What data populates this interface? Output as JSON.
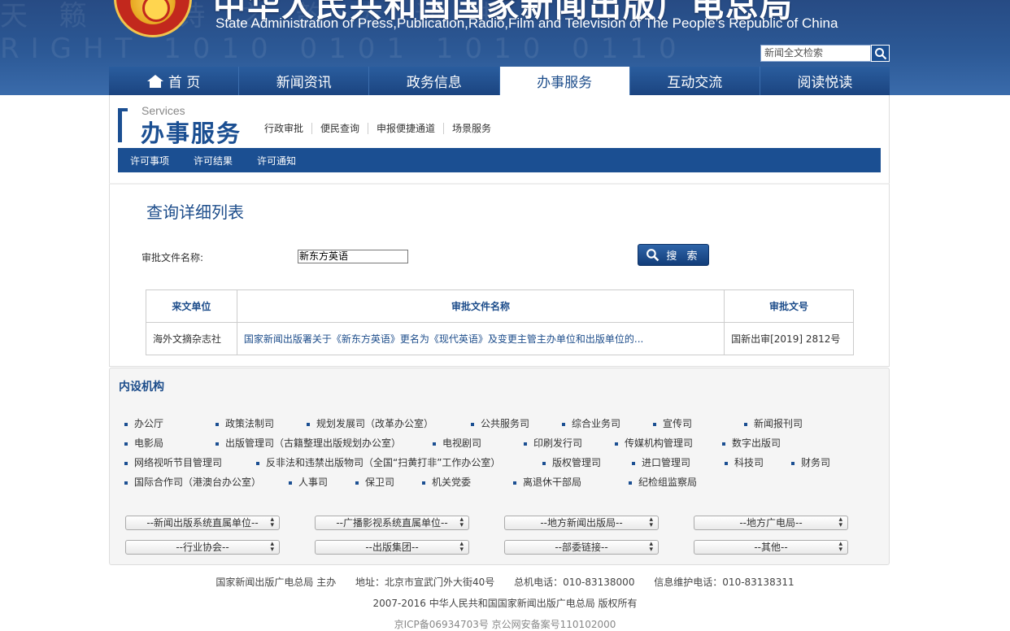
{
  "header": {
    "site_name_cn": "中华人民共和国国家新闻出版广电总局",
    "site_name_en": "State Administration of Press,Publication,Radio,Film and Television of The People’s Republic of China",
    "search_placeholder": "新闻全文检索",
    "nav": [
      {
        "label": "首 页",
        "active": false
      },
      {
        "label": "新闻资讯",
        "active": false
      },
      {
        "label": "政务信息",
        "active": false
      },
      {
        "label": "办事服务",
        "active": true
      },
      {
        "label": "互动交流",
        "active": false
      },
      {
        "label": "阅读悦读",
        "active": false
      }
    ]
  },
  "section": {
    "title_en": "Services",
    "title_cn": "办事服务",
    "subnav": [
      "行政审批",
      "便民查询",
      "申报便捷通道",
      "场景服务"
    ],
    "tabs": [
      "许可事项",
      "许可结果",
      "许可通知"
    ]
  },
  "query": {
    "title": "查询详细列表",
    "label": "审批文件名称:",
    "value": "新东方英语",
    "button": "搜 索"
  },
  "table": {
    "headers": [
      "来文单位",
      "审批文件名称",
      "审批文号"
    ],
    "rows": [
      {
        "unit": "海外文摘杂志社",
        "name": "国家新闻出版署关于《新东方英语》更名为《现代英语》及变更主管主办单位和出版单位的...",
        "number": "国新出审[2019] 2812号"
      }
    ]
  },
  "orgs": {
    "title": "内设机构",
    "items": [
      "办公厅",
      "政策法制司",
      "规划发展司（改革办公室）",
      "公共服务司",
      "综合业务司",
      "宣传司",
      "新闻报刊司",
      "电影局",
      "出版管理司（古籍整理出版规划办公室）",
      "电视剧司",
      "印刷发行司",
      "传媒机构管理司",
      "数字出版司",
      "网络视听节目管理司",
      "反非法和违禁出版物司（全国“扫黄打非”工作办公室）",
      "版权管理司",
      "进口管理司",
      "科技司",
      "财务司",
      "国际合作司（港澳台办公室）",
      "人事司",
      "保卫司",
      "机关党委",
      "离退休干部局",
      "纪检组监察局"
    ],
    "selects": [
      "--新闻出版系统直属单位--",
      "--广播影视系统直属单位--",
      "--地方新闻出版局--",
      "--地方广电局--",
      "--行业协会--",
      "--出版集团--",
      "--部委链接--",
      "--其他--"
    ]
  },
  "footer": {
    "sponsor": "国家新闻出版广电总局 主办",
    "address": "地址：北京市宣武门外大街40号",
    "phone": "总机电话：010-83138000",
    "info_phone": "信息维护电话：010-83138311",
    "copyright": "2007-2016 中华人民共和国国家新闻出版广电总局 版权所有",
    "icp": "京ICP备06934703号    京公网安备案号110102000"
  }
}
